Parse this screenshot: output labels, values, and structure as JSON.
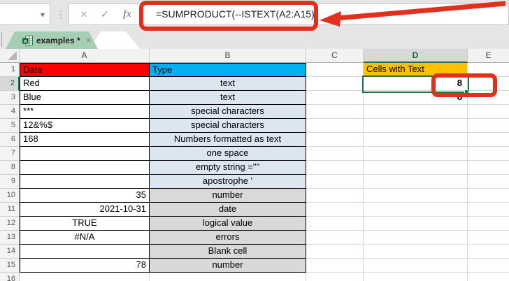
{
  "colors": {
    "header_red": "#FF0000",
    "header_cyan": "#00B0F0",
    "header_orange": "#FFC000",
    "fill_blue": "#DCE6F1",
    "fill_gray": "#D9D9D9",
    "annotation_red": "#E2301C",
    "selection_green": "#1E7145",
    "tab_green": "#A6CEB3"
  },
  "formula_bar": {
    "formula": "=SUMPRODUCT(--ISTEXT(A2:A15))",
    "name_box_value": "",
    "dropdown_glyph": "▾",
    "separator_glyph": "⋮",
    "cancel_glyph": "✕",
    "enter_glyph": "✓",
    "function_glyph": "fx"
  },
  "tabs": {
    "active_label": "examples *",
    "close_glyph": "×"
  },
  "sheet": {
    "column_headers": [
      "A",
      "B",
      "C",
      "D",
      "E"
    ],
    "row1": {
      "n": "1",
      "a": "Data",
      "b": "Type",
      "d": "Cells with Text"
    },
    "rows": [
      {
        "n": "2",
        "n_fmt": "selected",
        "a": "Red",
        "a_fmt": "table left",
        "b": "text",
        "b_fmt": "table center fill-blue",
        "d": "8",
        "d_fmt": "value"
      },
      {
        "n": "3",
        "a": "Blue",
        "a_fmt": "table left",
        "b": "text",
        "b_fmt": "table center fill-blue",
        "d": "8",
        "d_fmt": "value"
      },
      {
        "n": "4",
        "a": "***",
        "a_fmt": "table left",
        "b": "special characters",
        "b_fmt": "table center fill-blue"
      },
      {
        "n": "5",
        "a": "12&%$",
        "a_fmt": "table left",
        "b": "special characters",
        "b_fmt": "table center fill-blue"
      },
      {
        "n": "6",
        "a": "168",
        "a_fmt": "table left",
        "b": "Numbers formatted as text",
        "b_fmt": "table center fill-blue"
      },
      {
        "n": "7",
        "a": "",
        "a_fmt": "table left",
        "b": "one space",
        "b_fmt": "table center fill-blue"
      },
      {
        "n": "8",
        "a": "",
        "a_fmt": "table left",
        "b": "empty string =\"\"",
        "b_fmt": "table center fill-blue"
      },
      {
        "n": "9",
        "a": "",
        "a_fmt": "table left",
        "b": "apostrophe '",
        "b_fmt": "table center fill-blue"
      },
      {
        "n": "10",
        "a": "35",
        "a_fmt": "table right",
        "b": "number",
        "b_fmt": "table center fill-gray"
      },
      {
        "n": "11",
        "a": "2021-10-31",
        "a_fmt": "table right",
        "b": "date",
        "b_fmt": "table center fill-gray"
      },
      {
        "n": "12",
        "a": "TRUE",
        "a_fmt": "table center",
        "b": "logical value",
        "b_fmt": "table center fill-gray"
      },
      {
        "n": "13",
        "a": "#N/A",
        "a_fmt": "table center",
        "b": "errors",
        "b_fmt": "table center fill-gray"
      },
      {
        "n": "14",
        "a": "",
        "a_fmt": "table left",
        "b": "Blank cell",
        "b_fmt": "table center fill-gray"
      },
      {
        "n": "15",
        "a": "78",
        "a_fmt": "table right",
        "b": "number",
        "b_fmt": "table center fill-gray"
      },
      {
        "n": "16"
      }
    ]
  }
}
